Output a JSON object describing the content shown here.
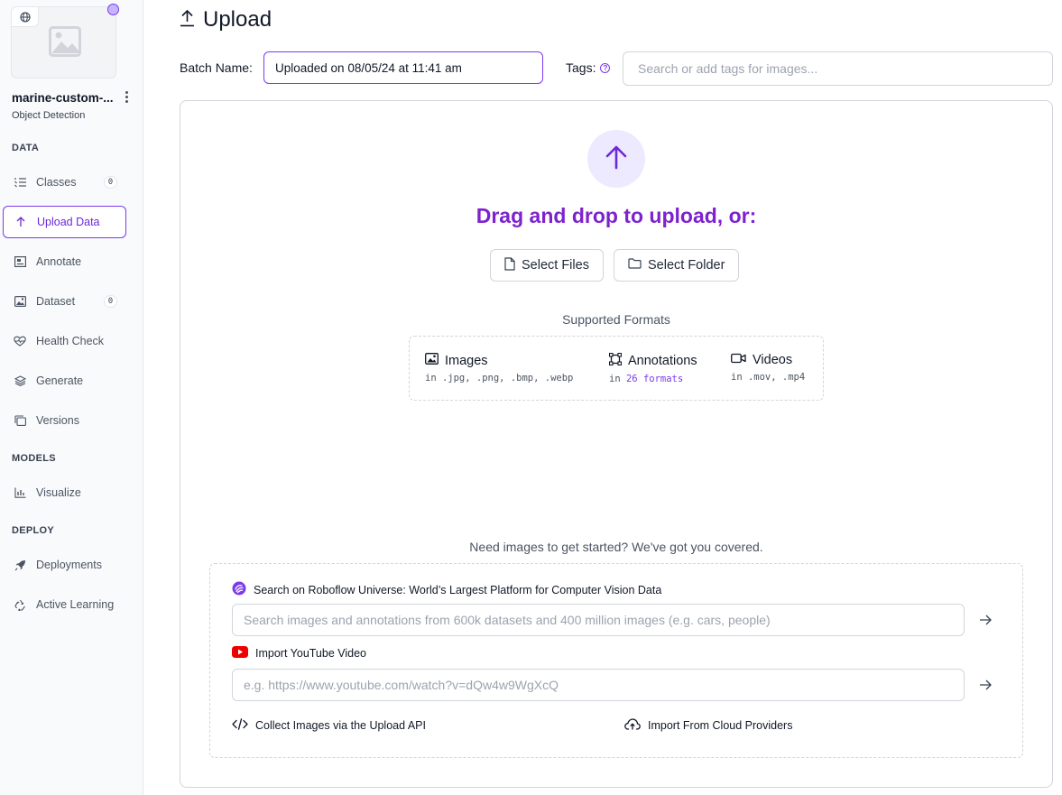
{
  "sidebar": {
    "project_name": "marine-custom-...",
    "project_type": "Object Detection",
    "sections": {
      "data": "DATA",
      "models": "MODELS",
      "deploy": "DEPLOY"
    },
    "items": {
      "classes": {
        "label": "Classes",
        "badge": "0"
      },
      "upload": {
        "label": "Upload Data"
      },
      "annotate": {
        "label": "Annotate"
      },
      "dataset": {
        "label": "Dataset",
        "badge": "0"
      },
      "health": {
        "label": "Health Check"
      },
      "generate": {
        "label": "Generate"
      },
      "versions": {
        "label": "Versions"
      },
      "visualize": {
        "label": "Visualize"
      },
      "deployments": {
        "label": "Deployments"
      },
      "active_learning": {
        "label": "Active Learning"
      }
    }
  },
  "header": {
    "title": "Upload",
    "batch_label": "Batch Name:",
    "batch_value": "Uploaded on 08/05/24 at 11:41 am",
    "tags_label": "Tags:",
    "tags_placeholder": "Search or add tags for images..."
  },
  "upload": {
    "drag_text": "Drag and drop to upload, or:",
    "select_files": "Select Files",
    "select_folder": "Select Folder",
    "supported_title": "Supported Formats",
    "formats": {
      "images": {
        "title": "Images",
        "desc": "in .jpg, .png, .bmp, .webp"
      },
      "annotations": {
        "title": "Annotations",
        "desc_prefix": "in",
        "desc_link": "26 formats"
      },
      "videos": {
        "title": "Videos",
        "desc": "in .mov, .mp4"
      }
    }
  },
  "resources": {
    "title": "Need images to get started? We've got you covered.",
    "universe_label": "Search on Roboflow Universe: World’s Largest Platform for Computer Vision Data",
    "universe_placeholder": "Search images and annotations from 600k datasets and 400 million images (e.g. cars, people)",
    "youtube_label": "Import YouTube Video",
    "youtube_placeholder": "e.g. https://www.youtube.com/watch?v=dQw4w9WgXcQ",
    "api_link": "Collect Images via the Upload API",
    "cloud_link": "Import From Cloud Providers"
  },
  "colors": {
    "accent": "#7c3aed",
    "heading_purple": "#7e22ce",
    "youtube_red": "#ef4444"
  }
}
